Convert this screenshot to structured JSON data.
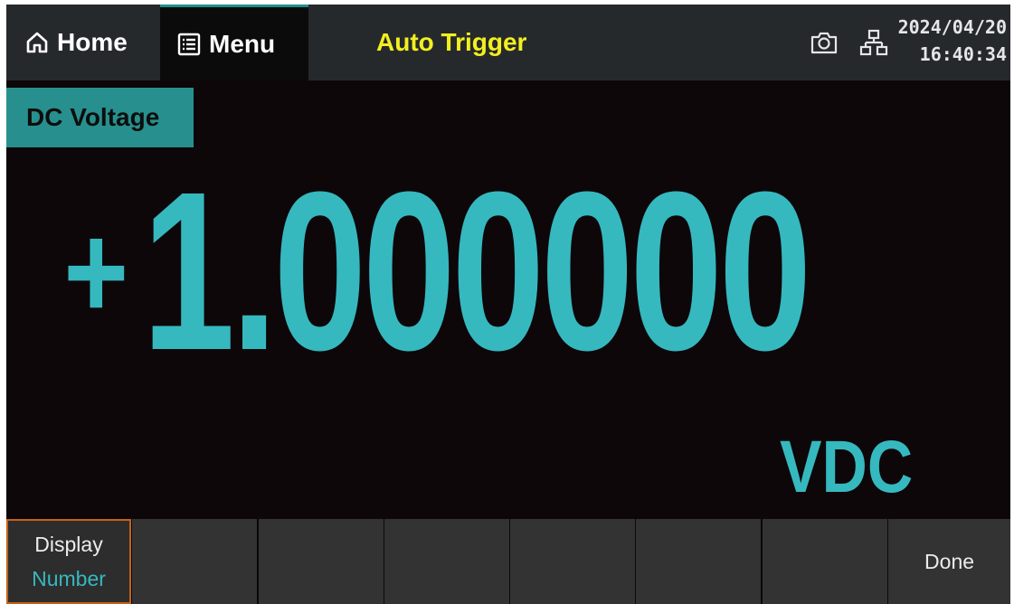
{
  "topbar": {
    "home_label": "Home",
    "home_icon": "home-icon",
    "menu_label": "Menu",
    "menu_icon": "list-menu-icon",
    "trigger_mode": "Auto Trigger",
    "trigger_color": "#f3ef1f",
    "status_icons": [
      "camera-icon",
      "network-icon"
    ],
    "date": "2024/04/20",
    "time": "16:40:34"
  },
  "measurement": {
    "function": "DC Voltage",
    "sign": "+",
    "value": "1.000000",
    "unit": "VDC",
    "accent_color": "#36b8bf",
    "badge_color": "#27908e"
  },
  "softkeys": [
    {
      "label": "Display",
      "value": "Number",
      "active": true
    },
    {
      "label": "",
      "value": ""
    },
    {
      "label": "",
      "value": ""
    },
    {
      "label": "",
      "value": ""
    },
    {
      "label": "",
      "value": ""
    },
    {
      "label": "",
      "value": ""
    },
    {
      "label": "",
      "value": ""
    },
    {
      "label": "Done",
      "value": ""
    }
  ]
}
